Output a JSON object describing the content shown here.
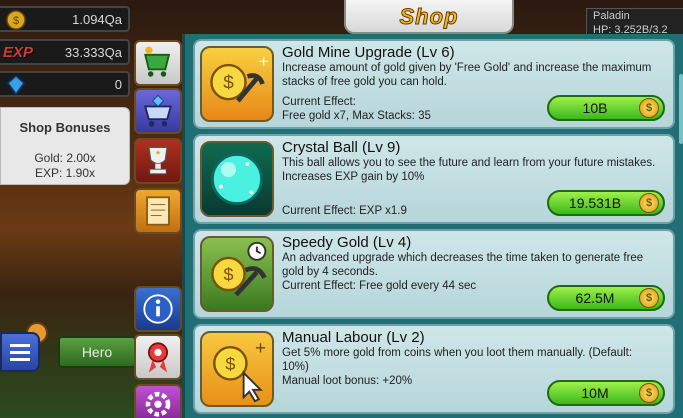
{
  "hud": {
    "gold_value": "1.094Qa",
    "exp_label": "EXP",
    "exp_value": "33.333Qa",
    "gems_value": "0"
  },
  "bonuses": {
    "title": "Shop Bonuses",
    "gold": "Gold: 2.00x",
    "exp": "EXP: 1.90x"
  },
  "header": {
    "title": "Shop"
  },
  "player": {
    "name": "Paladin",
    "hp": "HP: 3.252B/3.2"
  },
  "hero_button": "Hero",
  "tabs": [
    "shop-cart-tab",
    "gem-shop-tab",
    "trophy-tab",
    "quests-tab",
    "info-tab",
    "ribbon-tab",
    "settings-tab"
  ],
  "items": [
    {
      "name": "Gold Mine Upgrade (Lv 6)",
      "desc": "Increase amount of gold given by 'Free Gold' and increase the maximum stacks of free gold you can hold.",
      "effect_label": "Current Effect:",
      "effect": "Free gold x7, Max Stacks: 35",
      "price": "10B",
      "icon": "gold-mine-icon"
    },
    {
      "name": "Crystal Ball (Lv 9)",
      "desc": "This ball allows you to see the future and learn from your future mistakes. Increases EXP gain by 10%",
      "effect": "Current Effect: EXP x1.9",
      "price": "19.531B",
      "icon": "crystal-ball-icon"
    },
    {
      "name": "Speedy Gold (Lv 4)",
      "desc": "An advanced upgrade which decreases the time taken to generate free gold by 4 seconds.",
      "effect": "Current Effect: Free gold every 44 sec",
      "price": "62.5M",
      "icon": "speedy-gold-icon"
    },
    {
      "name": "Manual Labour (Lv 2)",
      "desc": "Get 5% more gold from coins when you loot them manually. (Default: 10%)",
      "effect": "Manual loot bonus: +20%",
      "price": "10M",
      "icon": "manual-labour-icon"
    }
  ],
  "colors": {
    "buy_button": "#3bb81c",
    "panel": "#1f6f75",
    "card": "#cfe6e8"
  }
}
